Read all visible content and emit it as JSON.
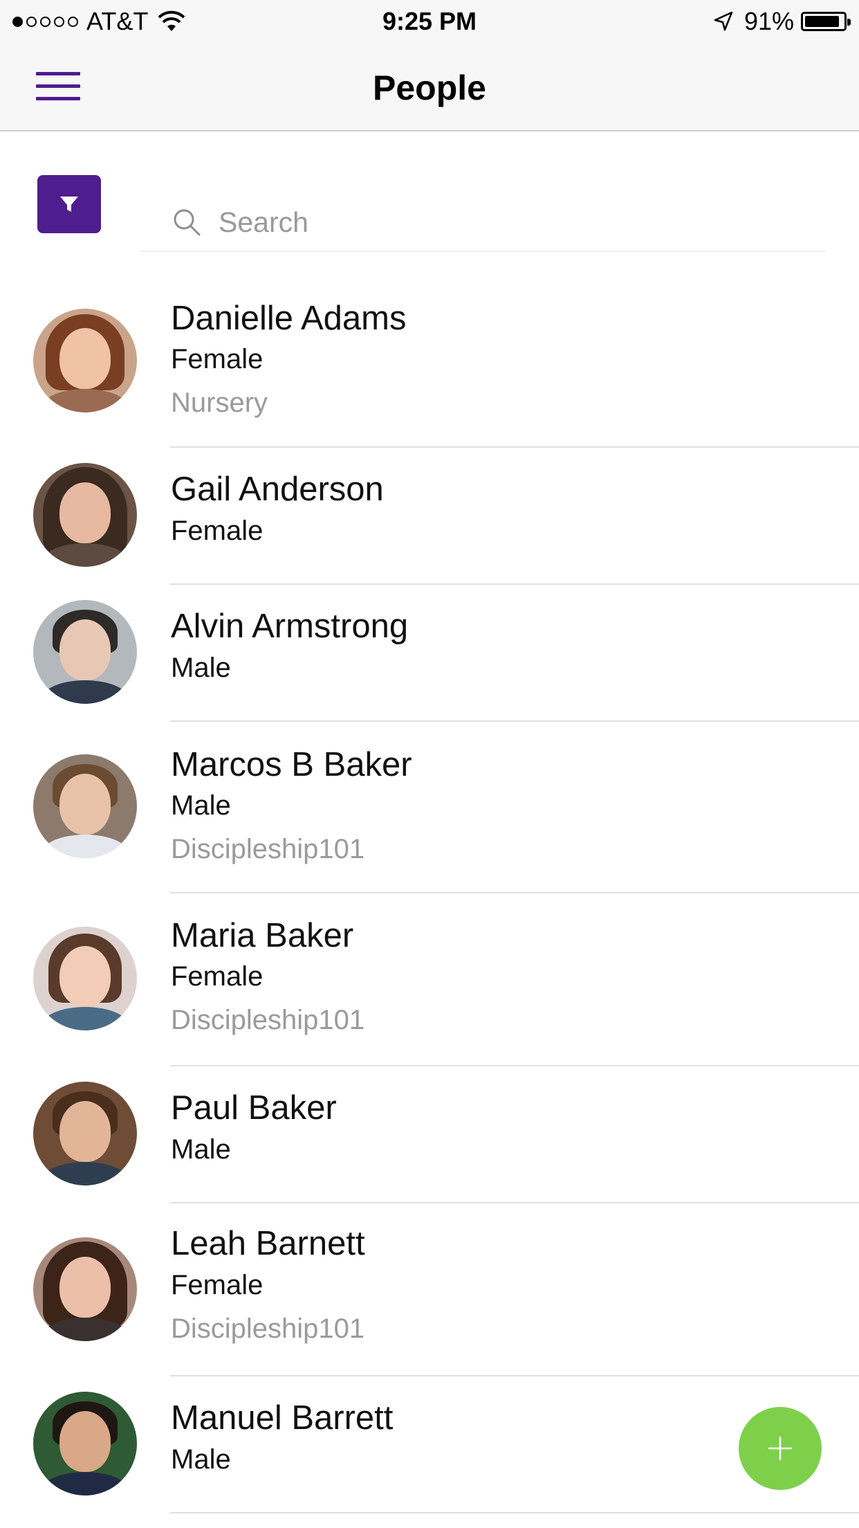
{
  "status_bar": {
    "carrier": "AT&T",
    "time": "9:25 PM",
    "battery": "91%",
    "battery_level": 0.91,
    "signal_bars_filled": 1,
    "signal_bars_total": 5
  },
  "nav": {
    "title": "People",
    "menu_icon": "hamburger-icon",
    "accent_color": "#4e1d8e"
  },
  "search": {
    "placeholder": "Search",
    "filter_icon": "filter-icon"
  },
  "people": [
    {
      "name": "Danielle Adams",
      "gender": "Female",
      "group": "Nursery"
    },
    {
      "name": "Gail Anderson",
      "gender": "Female",
      "group": ""
    },
    {
      "name": "Alvin Armstrong",
      "gender": "Male",
      "group": ""
    },
    {
      "name": "Marcos B Baker",
      "gender": "Male",
      "group": "Discipleship101"
    },
    {
      "name": "Maria Baker",
      "gender": "Female",
      "group": "Discipleship101"
    },
    {
      "name": "Paul Baker",
      "gender": "Male",
      "group": ""
    },
    {
      "name": "Leah Barnett",
      "gender": "Female",
      "group": "Discipleship101"
    },
    {
      "name": "Manuel Barrett",
      "gender": "Male",
      "group": ""
    }
  ],
  "fab": {
    "icon": "plus-icon",
    "color": "#7ed04b"
  }
}
